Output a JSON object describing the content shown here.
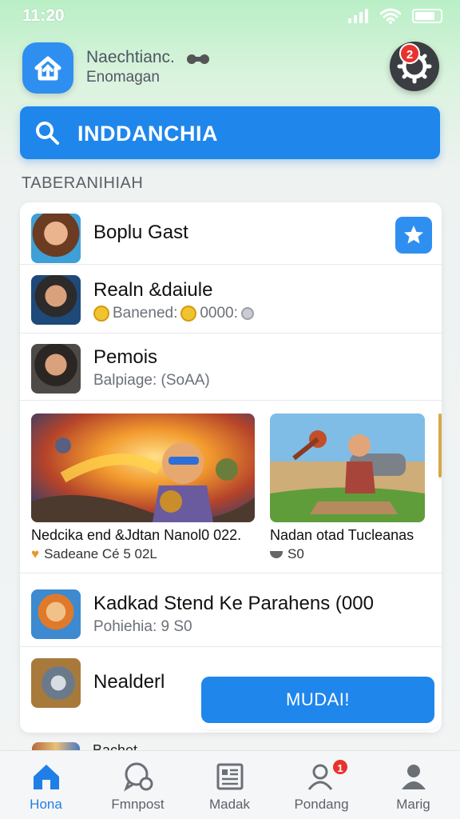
{
  "status_bar": {
    "time": "11:20"
  },
  "header": {
    "app_name": "Naechtianc.",
    "app_subtitle": "Enomagan",
    "notification_count": "2"
  },
  "search": {
    "label": "INDDANCHIA"
  },
  "section": {
    "title": "TABERANIHIAH"
  },
  "list": {
    "rows": [
      {
        "title": "Boplu Gast"
      },
      {
        "title": "Realn &daiule",
        "sub_label": "Banened:",
        "sub_value": "0000:"
      },
      {
        "title": "Pemois",
        "sub_label": "Balpiage: (SoAA)"
      }
    ],
    "gallery": [
      {
        "title": "Nedcika end &Jdtan Nanol0 022.",
        "sub": "Sadeane Cé 5 02L"
      },
      {
        "title": "Nadan otad Tucleanas",
        "sub": "S0"
      }
    ],
    "lower_rows": [
      {
        "title": "Kadkad Stend Ke Parahens (000",
        "sub_label": "Pohiehia: 9 S0"
      },
      {
        "title": "Nealderl"
      }
    ],
    "peek_text": "Bachet"
  },
  "action_button": {
    "label": "MUDAI!"
  },
  "bottom_nav": {
    "items": [
      {
        "label": "Hona",
        "icon": "home-icon",
        "active": true
      },
      {
        "label": "Fmnpost",
        "icon": "chat-icon",
        "active": false
      },
      {
        "label": "Madak",
        "icon": "news-icon",
        "active": false
      },
      {
        "label": "Pondang",
        "icon": "friends-icon",
        "active": false,
        "badge": "1"
      },
      {
        "label": "Marig",
        "icon": "profile-icon",
        "active": false
      }
    ]
  },
  "colors": {
    "accent": "#1f86ec",
    "badge": "#e8322d",
    "header_gradient_top": "#b9efc6",
    "background": "#f2f4f5"
  }
}
